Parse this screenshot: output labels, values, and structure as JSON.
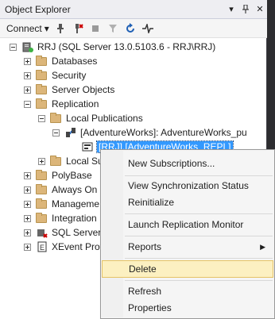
{
  "window": {
    "title": "Object Explorer",
    "pin_glyph": "▾",
    "pushpin_glyph": "⊣",
    "close_glyph": "✕"
  },
  "toolbar": {
    "connect_label": "Connect",
    "connect_arrow": "▾"
  },
  "tree": {
    "server_label": "RRJ (SQL Server 13.0.5103.6 - RRJ\\RRJ)",
    "databases": "Databases",
    "security": "Security",
    "server_objects": "Server Objects",
    "replication": "Replication",
    "local_publications": "Local Publications",
    "publication": "[AdventureWorks]: AdventureWorks_pu",
    "publication_item": "[RRJ].[AdventureWorks_REPL]",
    "local_subscriptions": "Local Su",
    "polybase": "PolyBase",
    "always_on": "Always On",
    "management": "Manageme",
    "integration": "Integration",
    "sql_server_agent": "SQL Server",
    "xevent": "XEvent Prof"
  },
  "context_menu": {
    "new_subscriptions": "New Subscriptions...",
    "view_sync_status": "View Synchronization Status",
    "reinitialize": "Reinitialize",
    "launch_monitor": "Launch Replication Monitor",
    "reports": "Reports",
    "reports_arrow": "▶",
    "delete": "Delete",
    "refresh": "Refresh",
    "properties": "Properties"
  },
  "colors": {
    "selection": "#3399ff",
    "menu_highlight": "#fcf0c1",
    "folder": "#dcb67a"
  }
}
